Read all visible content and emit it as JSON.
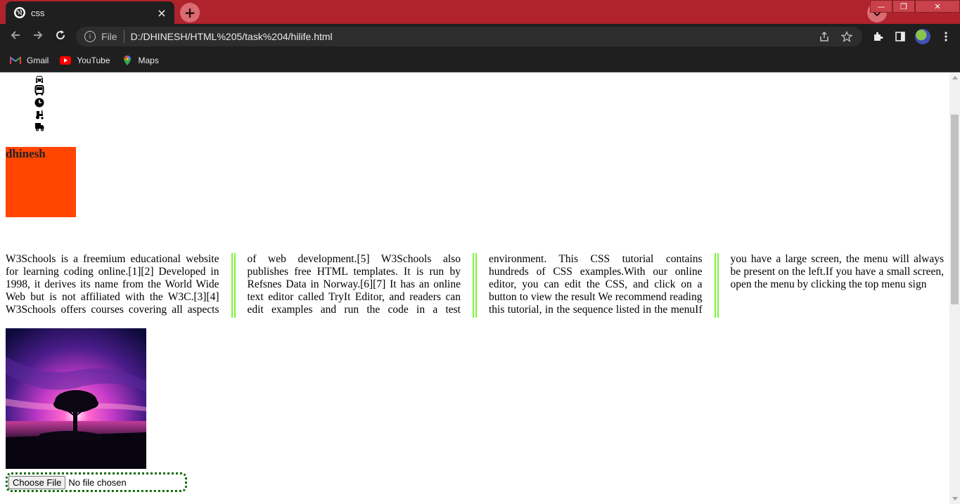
{
  "browser": {
    "tab_title": "css",
    "tab_close": "×",
    "new_tab": "+",
    "url_scheme": "File",
    "url": "D:/DHINESH/HTML%205/task%204/hilife.html",
    "window_controls": {
      "minimize": "—",
      "restore": "❐",
      "close": "✕"
    }
  },
  "bookmarks": [
    {
      "label": "Gmail",
      "icon": "gmail-icon"
    },
    {
      "label": "YouTube",
      "icon": "youtube-icon"
    },
    {
      "label": "Maps",
      "icon": "maps-icon"
    }
  ],
  "page": {
    "vertical_icons": [
      "car-icon",
      "bus-icon",
      "clock-icon",
      "tractor-icon",
      "truck-icon"
    ],
    "box_heading": "dhinesh",
    "box_color": "#ff4500",
    "column_text": "W3Schools is a freemium educational website for learning coding online.[1][2] Developed in 1998, it derives its name from the World Wide Web but is not affiliated with the W3C.[3][4] W3Schools offers courses covering all aspects of web development.[5] W3Schools also publishes free HTML templates. It is run by Refsnes Data in Norway.[6][7] It has an online text editor called TryIt Editor, and readers can edit examples and run the code in a test environment. This CSS tutorial contains hundreds of CSS examples.With our online editor, you can edit the CSS, and click on a button to view the result We recommend reading this tutorial, in the sequence listed in the menuIf you have a large screen, the menu will always be present on the left.If you have a small screen, open the menu by clicking the top menu sign",
    "column_rule_color": "#7cf53a",
    "image_subject": "tree-at-sunset",
    "file_input": {
      "button": "Choose File",
      "status": "No file chosen"
    }
  }
}
